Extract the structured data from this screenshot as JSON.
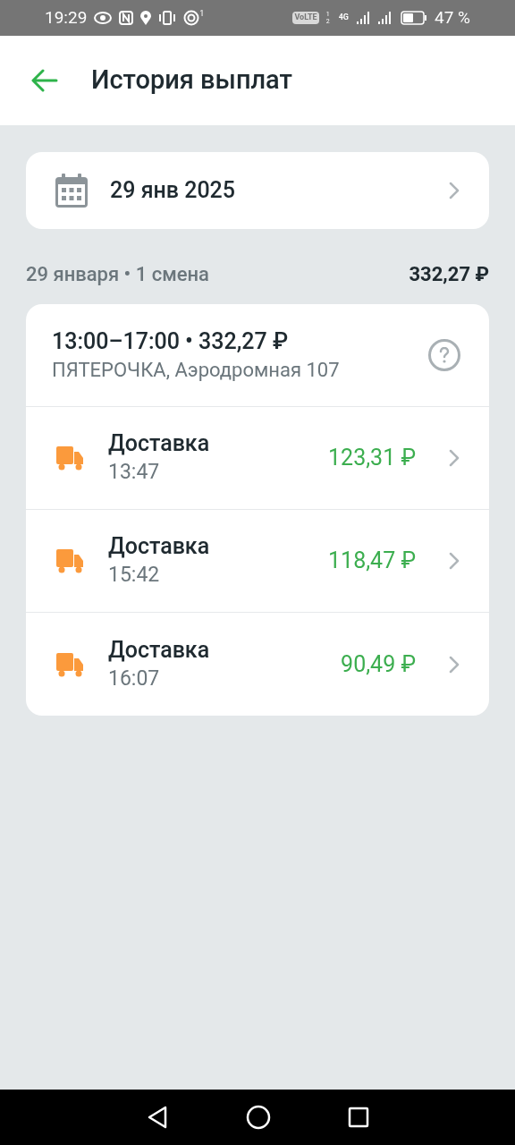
{
  "status_bar": {
    "time": "19:29",
    "notification_badge": "1",
    "volte": "VoLTE",
    "sim_indices": "1 2",
    "network": "4G",
    "battery": "47 %"
  },
  "header": {
    "title": "История выплат"
  },
  "date_picker": {
    "value": "29 янв 2025"
  },
  "summary": {
    "label": "29 января • 1 смена",
    "total": "332,27 ₽"
  },
  "shift": {
    "title": "13:00–17:00 • 332,27 ₽",
    "store": "ПЯТЕРОЧКА, Аэродромная 107",
    "items": [
      {
        "kind": "delivery",
        "title": "Доставка",
        "time": "13:47",
        "amount": "123,31 ₽"
      },
      {
        "kind": "delivery",
        "title": "Доставка",
        "time": "15:42",
        "amount": "118,47 ₽"
      },
      {
        "kind": "delivery",
        "title": "Доставка",
        "time": "16:07",
        "amount": "90,49 ₽"
      }
    ]
  }
}
